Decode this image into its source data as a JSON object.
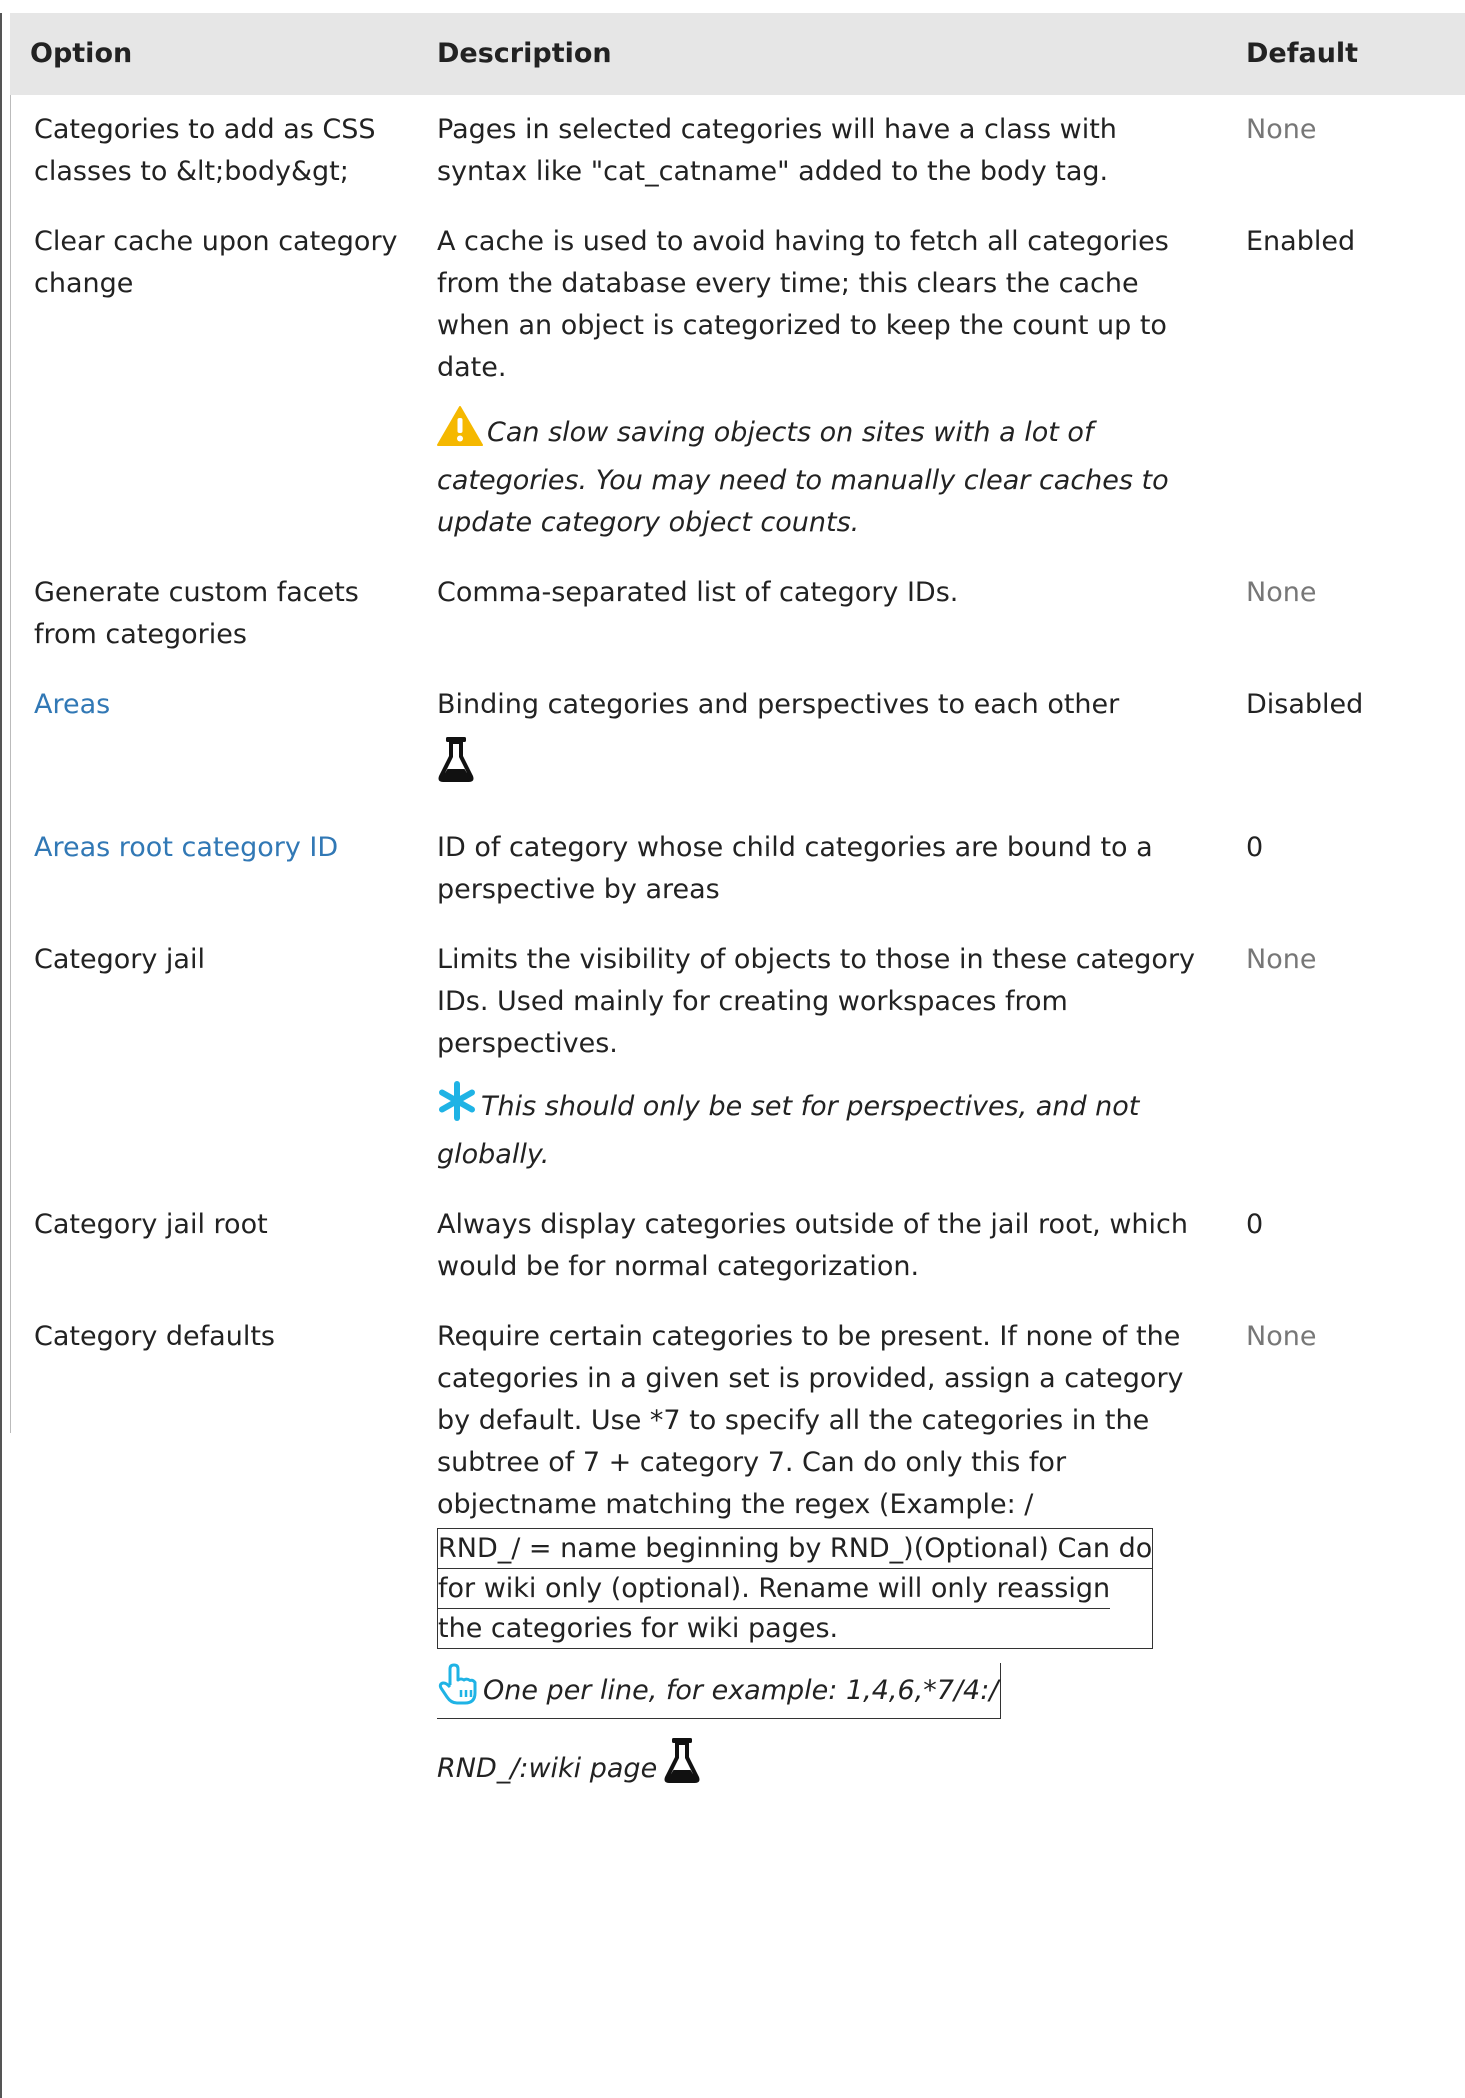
{
  "table": {
    "headers": {
      "option": "Option",
      "description": "Description",
      "default": "Default"
    },
    "rows": [
      {
        "option": "Categories to add as CSS classes to &lt;body&gt;",
        "description": "Pages in selected categories will have a class with syntax like \"cat_catname\" added to the body tag.",
        "default": "None"
      },
      {
        "option": "Clear cache upon category change",
        "description": "A cache is used to avoid having to fetch all categories from the database every time; this clears the cache when an object is categorized to keep the count up to date.",
        "note": "Can slow saving objects on sites with a lot of categories. You may need to manually clear caches to update category object counts.",
        "default": "Enabled"
      },
      {
        "option": "Generate custom facets from categories",
        "description": "Comma-separated list of category IDs.",
        "default": "None"
      },
      {
        "option": "Areas",
        "description": "Binding categories and perspectives to each other",
        "default": "Disabled"
      },
      {
        "option": "Areas root category ID",
        "description": "ID of category whose child categories are bound to a perspective by areas",
        "default": "0"
      },
      {
        "option": "Category jail",
        "description": "Limits the visibility of objects to those in these category IDs. Used mainly for creating workspaces from perspectives.",
        "note": "This should only be set for perspectives, and not globally.",
        "default": "None"
      },
      {
        "option": "Category jail root",
        "description": "Always display categories outside of the jail root, which would be for normal categorization.",
        "default": "0"
      },
      {
        "option": "Category defaults",
        "description": "Require certain categories to be present. If none of the categories in a given set is provided, assign a category by default. Use *7 to specify all the categories in the subtree of 7 + category 7. Can do only this for objectname matching the regex (Example: /",
        "description_boxed": [
          "RND_/ = name beginning by RND_)(Optional) Can do",
          "for wiki only (optional). Rename will only reassign",
          "the categories for wiki pages."
        ],
        "note_line1": "One per line, for example: 1,4,6,*7/4:/",
        "note_line2": "RND_/:wiki page",
        "default": "None"
      }
    ]
  },
  "icons": {
    "warning": "warning-icon",
    "flask": "flask-icon",
    "asterisk": "asterisk-icon",
    "pointer": "pointing-hand-icon"
  },
  "colors": {
    "header_bg": "#e6e6e6",
    "link": "#3178b5",
    "muted": "#777777",
    "warning": "#f5b800",
    "info": "#1fb3e5"
  }
}
